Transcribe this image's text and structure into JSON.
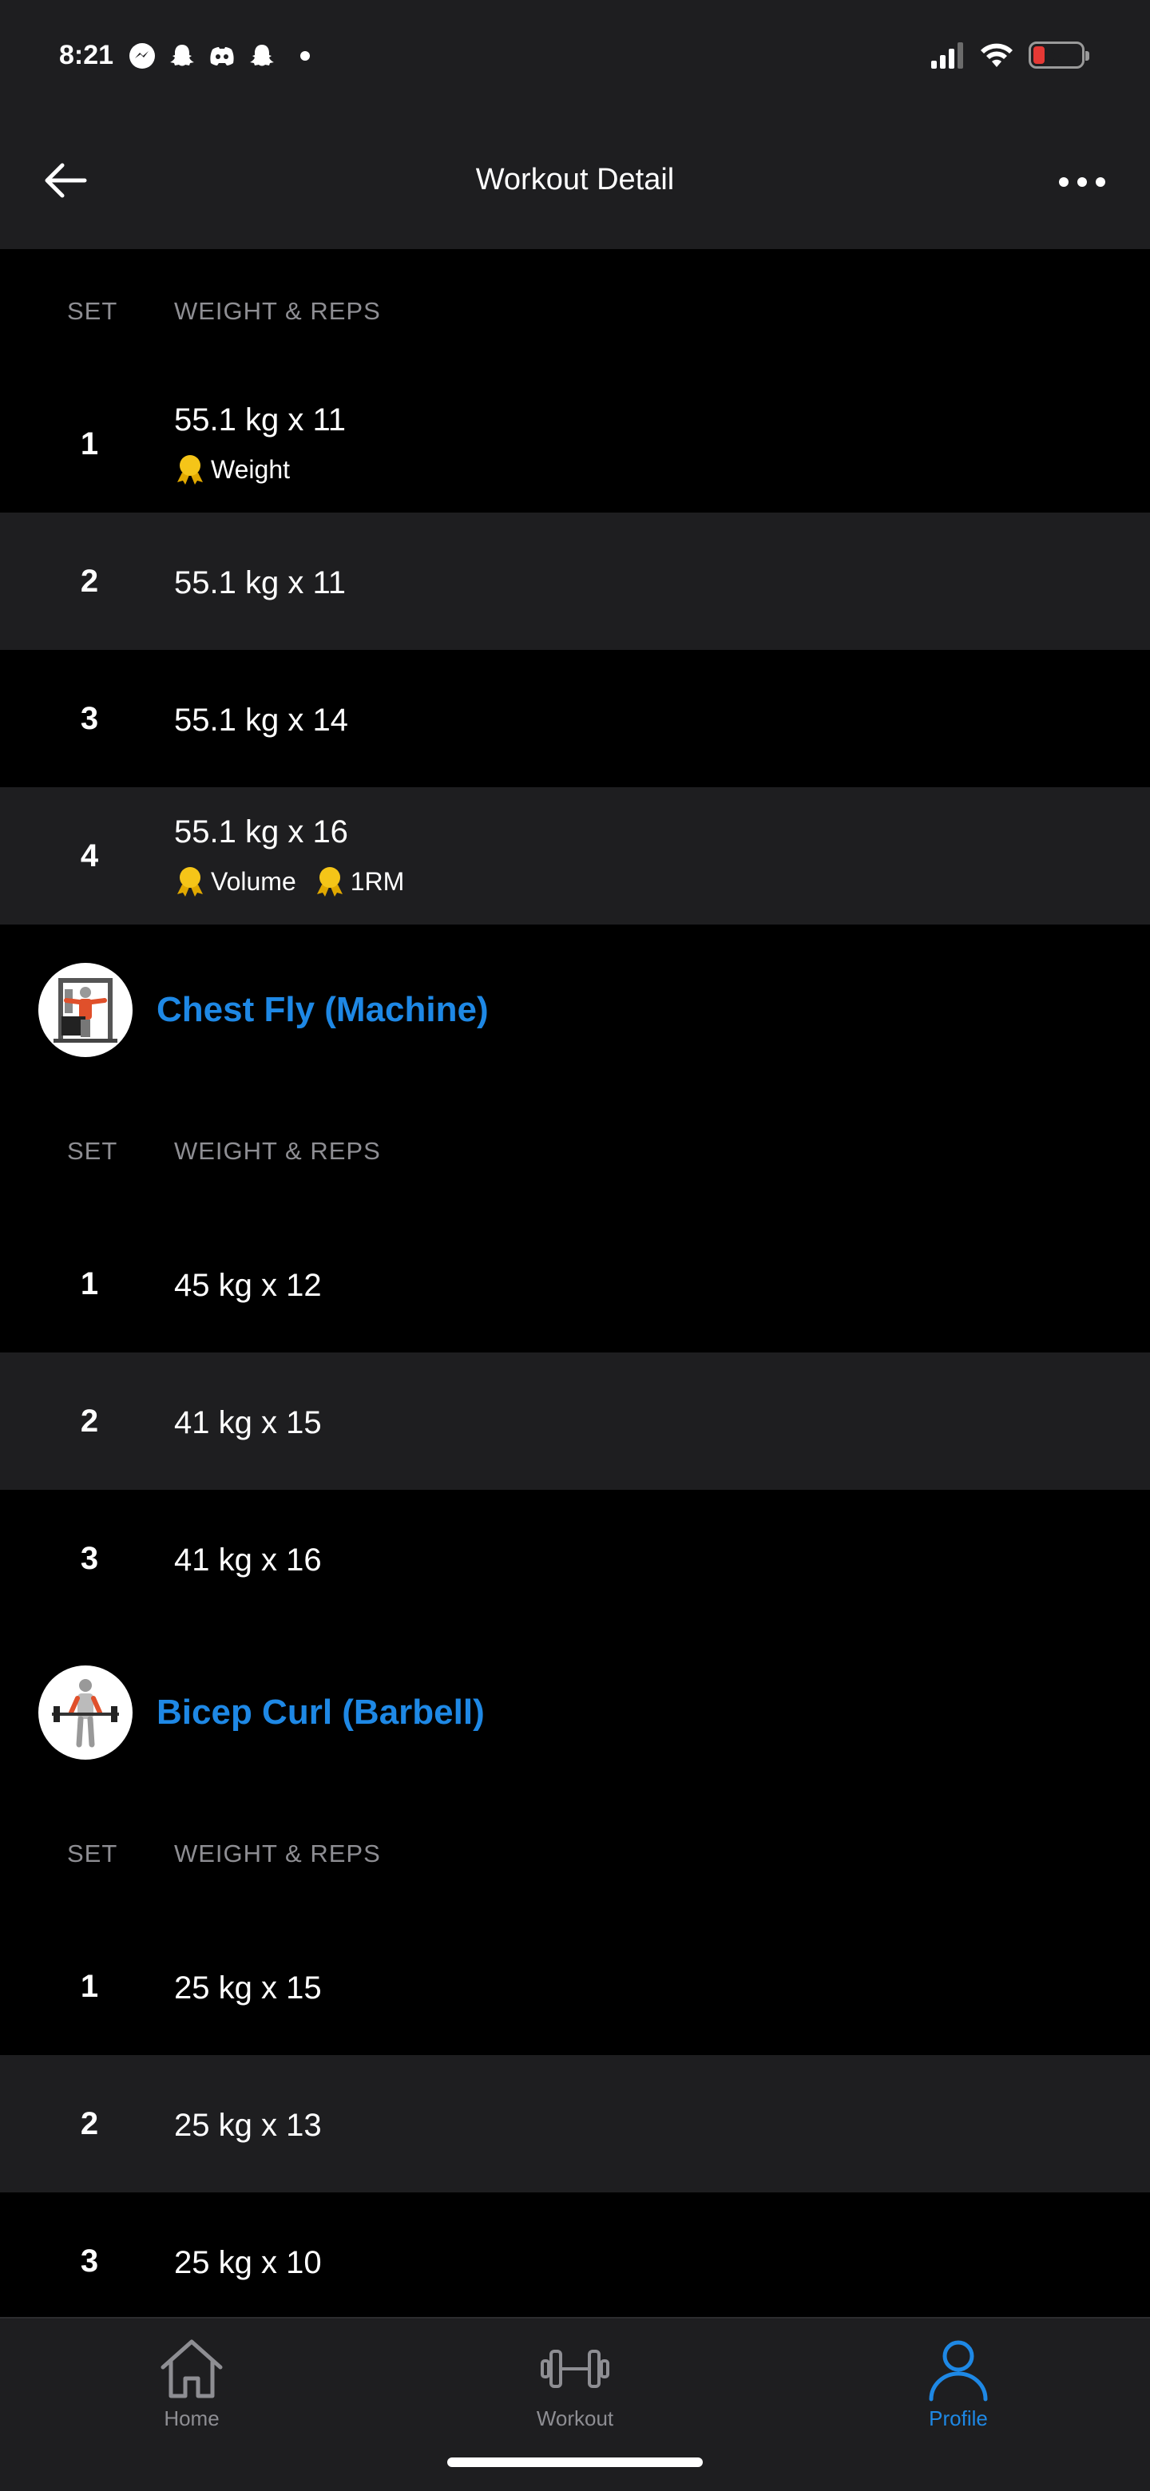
{
  "status": {
    "time": "8:21",
    "battery_level": "6"
  },
  "header": {
    "title": "Workout Detail"
  },
  "columns": {
    "set": "SET",
    "weight_reps": "WEIGHT & REPS"
  },
  "exercises": [
    {
      "sets": [
        {
          "num": "1",
          "value": "55.1 kg x 11",
          "records": [
            "Weight"
          ]
        },
        {
          "num": "2",
          "value": "55.1 kg x 11"
        },
        {
          "num": "3",
          "value": "55.1 kg x 14"
        },
        {
          "num": "4",
          "value": "55.1 kg x 16",
          "records": [
            "Volume",
            "1RM"
          ]
        }
      ]
    },
    {
      "name": "Chest Fly (Machine)",
      "sets": [
        {
          "num": "1",
          "value": "45 kg x 12"
        },
        {
          "num": "2",
          "value": "41 kg x 15"
        },
        {
          "num": "3",
          "value": "41 kg x 16"
        }
      ]
    },
    {
      "name": "Bicep Curl (Barbell)",
      "sets": [
        {
          "num": "1",
          "value": "25 kg x 15"
        },
        {
          "num": "2",
          "value": "25 kg x 13"
        },
        {
          "num": "3",
          "value": "25 kg x 10"
        }
      ]
    }
  ],
  "tabs": [
    {
      "label": "Home",
      "icon": "home-icon",
      "active": false
    },
    {
      "label": "Workout",
      "icon": "dumbbell-icon",
      "active": false
    },
    {
      "label": "Profile",
      "icon": "profile-icon",
      "active": true
    }
  ],
  "colors": {
    "accent": "#1e88e5",
    "medal": "#f5c518",
    "alt_row": "#1e1e20",
    "background": "#000000"
  }
}
